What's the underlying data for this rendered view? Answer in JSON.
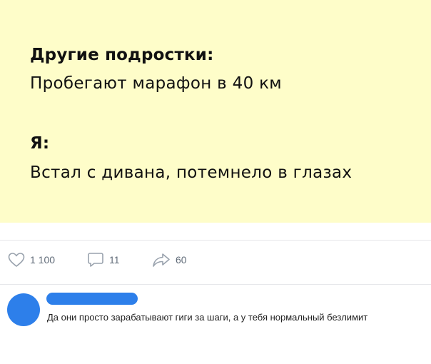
{
  "meme": {
    "heading1": "Другие подростки:",
    "text1": "Пробегают марафон в 40 км",
    "heading2": "Я:",
    "text2": "Встал с дивана, потемнело в глазах",
    "background": "#fefdc9"
  },
  "actions": {
    "likes": "1 100",
    "comments": "11",
    "shares": "60"
  },
  "comment": {
    "text": "Да они просто зарабатывают гиги за шаги, а у тебя нормальный безлимит",
    "avatar_color": "#2d7fea"
  }
}
